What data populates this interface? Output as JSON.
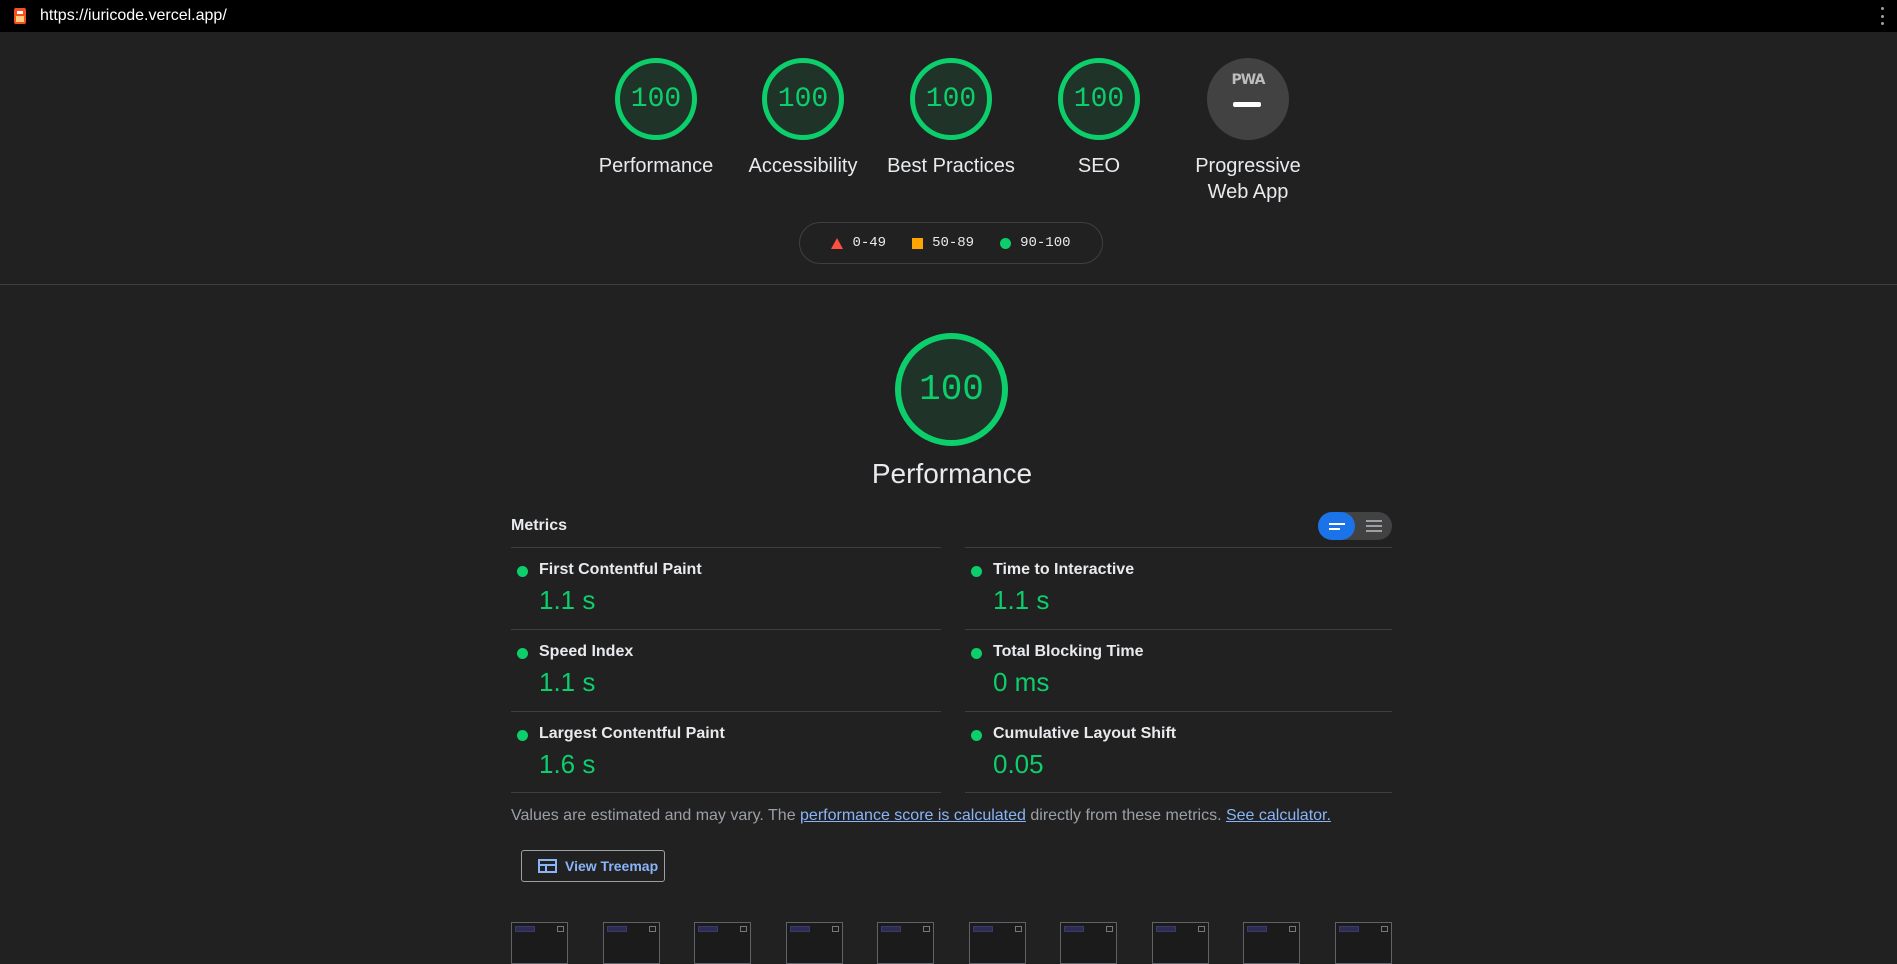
{
  "browser": {
    "url": "https://iuricode.vercel.app/"
  },
  "summary_gauges": [
    {
      "score": "100",
      "label": "Performance"
    },
    {
      "score": "100",
      "label": "Accessibility"
    },
    {
      "score": "100",
      "label": "Best Practices"
    },
    {
      "score": "100",
      "label": "SEO"
    }
  ],
  "pwa": {
    "badge_text": "PWA",
    "label": "Progressive Web App"
  },
  "legend": [
    {
      "range": "0-49",
      "color": "#ff4e42"
    },
    {
      "range": "50-89",
      "color": "#ffa400"
    },
    {
      "range": "90-100",
      "color": "#0cce6b"
    }
  ],
  "performance": {
    "score": "100",
    "title": "Performance",
    "metrics_title": "Metrics",
    "metrics": [
      {
        "label": "First Contentful Paint",
        "value": "1.1 s"
      },
      {
        "label": "Time to Interactive",
        "value": "1.1 s"
      },
      {
        "label": "Speed Index",
        "value": "1.1 s"
      },
      {
        "label": "Total Blocking Time",
        "value": "0 ms"
      },
      {
        "label": "Largest Contentful Paint",
        "value": "1.6 s"
      },
      {
        "label": "Cumulative Layout Shift",
        "value": "0.05"
      }
    ],
    "note": {
      "prefix": "Values are estimated and may vary. The ",
      "link1": "performance score is calculated",
      "middle": " directly from these metrics. ",
      "link2": "See calculator."
    },
    "treemap_button": "View Treemap",
    "filmstrip_frame_count": 10
  },
  "colors": {
    "pass": "#0cce6b",
    "average": "#ffa400",
    "fail": "#ff4e42",
    "link": "#8ab4f8",
    "background": "#212121"
  }
}
